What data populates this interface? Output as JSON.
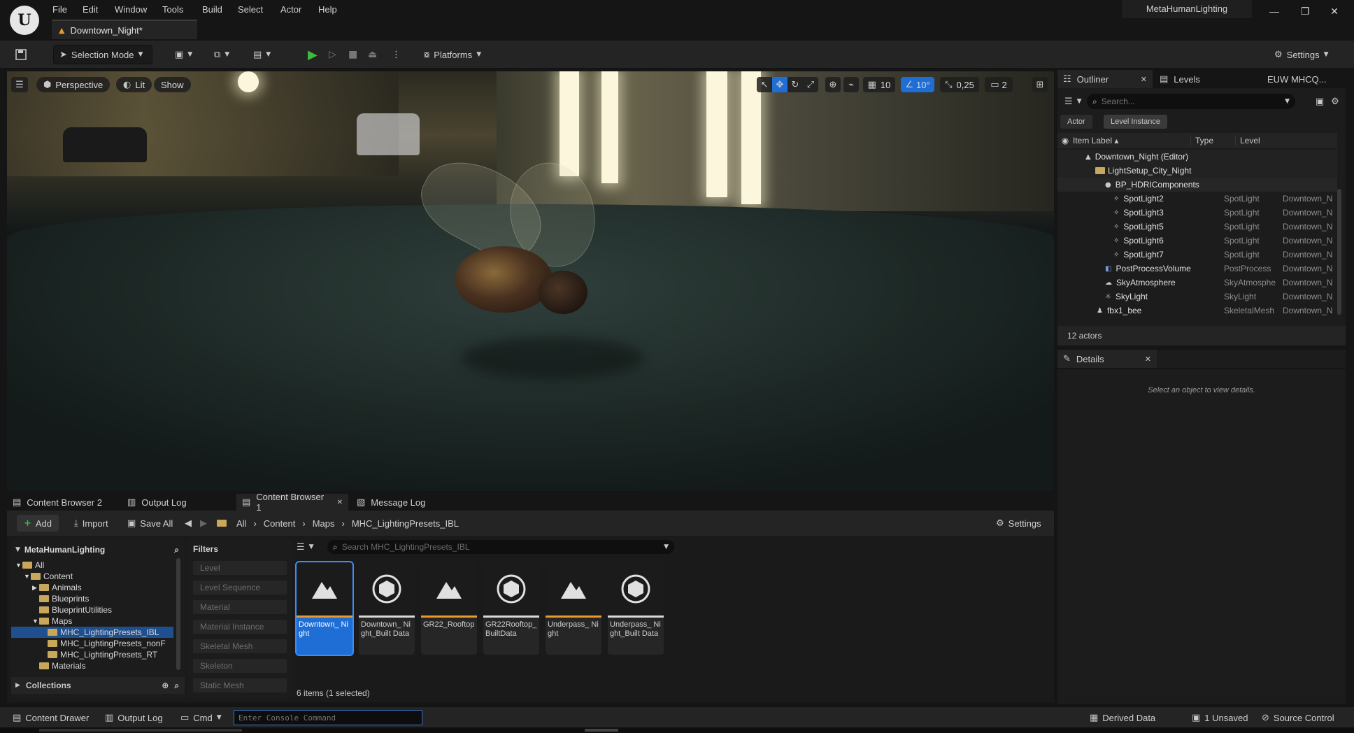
{
  "menu": [
    "File",
    "Edit",
    "Window",
    "Tools",
    "Build",
    "Select",
    "Actor",
    "Help"
  ],
  "document_tab": "Downtown_Night*",
  "project_name": "MetaHumanLighting",
  "window_controls": {
    "minimize": "—",
    "restore": "❐",
    "close": "✕"
  },
  "toolbar": {
    "selection_mode": "Selection Mode",
    "platforms": "Platforms",
    "settings": "Settings"
  },
  "viewport": {
    "perspective": "Perspective",
    "lit": "Lit",
    "show": "Show",
    "grid_snap": "10",
    "rotation_snap": "10°",
    "scale_snap": "0,25",
    "camera_speed": "2"
  },
  "outliner": {
    "tab_outliner": "Outliner",
    "tab_levels": "Levels",
    "tab_extra": "EUW MHCQ...",
    "search_placeholder": "Search...",
    "filter_actor": "Actor",
    "filter_level_instance": "Level Instance",
    "col_label": "Item Label ▴",
    "col_type": "Type",
    "col_level": "Level",
    "rows": [
      {
        "label": "Downtown_Night (Editor)",
        "type": "",
        "level": ""
      },
      {
        "label": "LightSetup_City_Night",
        "type": "",
        "level": ""
      },
      {
        "label": "BP_HDRIComponents",
        "type": "",
        "level": ""
      },
      {
        "label": "SpotLight2",
        "type": "SpotLight",
        "level": "Downtown_N"
      },
      {
        "label": "SpotLight3",
        "type": "SpotLight",
        "level": "Downtown_N"
      },
      {
        "label": "SpotLight5",
        "type": "SpotLight",
        "level": "Downtown_N"
      },
      {
        "label": "SpotLight6",
        "type": "SpotLight",
        "level": "Downtown_N"
      },
      {
        "label": "SpotLight7",
        "type": "SpotLight",
        "level": "Downtown_N"
      },
      {
        "label": "PostProcessVolume",
        "type": "PostProcess",
        "level": "Downtown_N"
      },
      {
        "label": "SkyAtmosphere",
        "type": "SkyAtmosphe",
        "level": "Downtown_N"
      },
      {
        "label": "SkyLight",
        "type": "SkyLight",
        "level": "Downtown_N"
      },
      {
        "label": "fbx1_bee",
        "type": "SkeletalMesh",
        "level": "Downtown_N"
      }
    ],
    "footer": "12 actors"
  },
  "details": {
    "tab": "Details",
    "empty_message": "Select an object to view details."
  },
  "content_browser": {
    "tabs": [
      "Content Browser 2",
      "Output Log",
      "Content Browser 1",
      "Message Log"
    ],
    "add": "Add",
    "import": "Import",
    "save_all": "Save All",
    "breadcrumb": [
      "All",
      "Content",
      "Maps",
      "MHC_LightingPresets_IBL"
    ],
    "settings": "Settings",
    "tree_root": "MetaHumanLighting",
    "tree": [
      {
        "label": "All",
        "indent": 1
      },
      {
        "label": "Content",
        "indent": 2
      },
      {
        "label": "Animals",
        "indent": 3
      },
      {
        "label": "Blueprints",
        "indent": 3
      },
      {
        "label": "BlueprintUtilities",
        "indent": 3
      },
      {
        "label": "Maps",
        "indent": 3
      },
      {
        "label": "MHC_LightingPresets_IBL",
        "indent": 4
      },
      {
        "label": "MHC_LightingPresets_nonF",
        "indent": 4
      },
      {
        "label": "MHC_LightingPresets_RT",
        "indent": 4
      },
      {
        "label": "Materials",
        "indent": 3
      }
    ],
    "collections": "Collections",
    "filters_title": "Filters",
    "filters": [
      "Level",
      "Level Sequence",
      "Material",
      "Material Instance",
      "Skeletal Mesh",
      "Skeleton",
      "Static Mesh"
    ],
    "search_placeholder": "Search MHC_LightingPresets_IBL",
    "assets": [
      {
        "name": "Downtown_ Night",
        "kind": "map",
        "selected": true
      },
      {
        "name": "Downtown_ Night_Built Data",
        "kind": "data",
        "selected": false
      },
      {
        "name": "GR22_Rooftop",
        "kind": "map",
        "selected": false
      },
      {
        "name": "GR22Rooftop_ BuiltData",
        "kind": "data",
        "selected": false
      },
      {
        "name": "Underpass_ Night",
        "kind": "map",
        "selected": false
      },
      {
        "name": "Underpass_ Night_Built Data",
        "kind": "data",
        "selected": false
      }
    ],
    "item_count": "6 items (1 selected)"
  },
  "statusbar": {
    "content_drawer": "Content Drawer",
    "output_log": "Output Log",
    "cmd": "Cmd",
    "console_placeholder": "Enter Console Command",
    "derived_data": "Derived Data",
    "unsaved": "1 Unsaved",
    "source_control": "Source Control"
  },
  "colors": {
    "accent": "#1f6ed6",
    "map_bar": "#e89a2c",
    "data_bar": "#d8d8d8",
    "play_green": "#3dbb3d"
  }
}
